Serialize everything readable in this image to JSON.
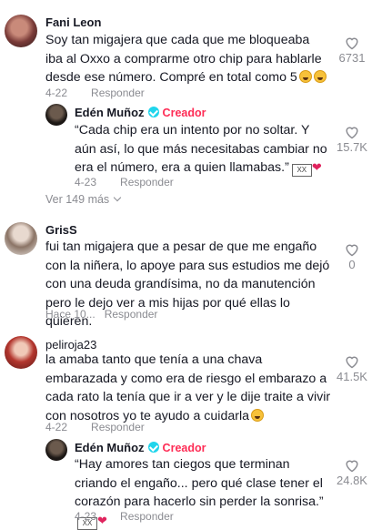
{
  "comments": [
    {
      "user": "Fani Leon",
      "text": "Soy tan migajera que cada que me bloqueaba iba al Oxxo a comprarme otro chip para hablarle desde ese número. Compré en total como 5",
      "date": "4-22",
      "reply_label": "Responder",
      "likes": "6731",
      "reply": {
        "user": "Edén Muñoz",
        "badge": "Creador",
        "text": "“Cada chip era un intento por no soltar. Y aún así, lo que más necesitabas cambiar no era el número, era a quien llamabas.”",
        "date": "4-23",
        "reply_label": "Responder",
        "likes": "15.7K"
      },
      "more_label": "Ver 149 más"
    },
    {
      "user": "GrisS",
      "text": "fui tan migajera que a pesar de que me engaño con la niñera, lo apoye para sus estudios me dejó con una deuda grandísima, no da manutención pero le dejo ver a mis hijas por qué ellas lo quieren.",
      "date": "Hace 10...",
      "reply_label": "Responder",
      "likes": "0"
    },
    {
      "user": "peliroja23",
      "text": "la amaba tanto que tenía a una chava embarazada y como era de riesgo el embarazo a cada rato la tenía que ir a ver y le dije traite a vivir con nosotros yo te ayudo a cuidarla",
      "date": "4-22",
      "reply_label": "Responder",
      "likes": "41.5K",
      "reply": {
        "user": "Edén Muñoz",
        "badge": "Creador",
        "text": "“Hay amores tan ciegos que terminan criando el engaño... pero qué clase tener el corazón para hacerlo sin perder la sonrisa.”",
        "date": "4-23",
        "reply_label": "Responder",
        "likes": "24.8K"
      }
    }
  ]
}
